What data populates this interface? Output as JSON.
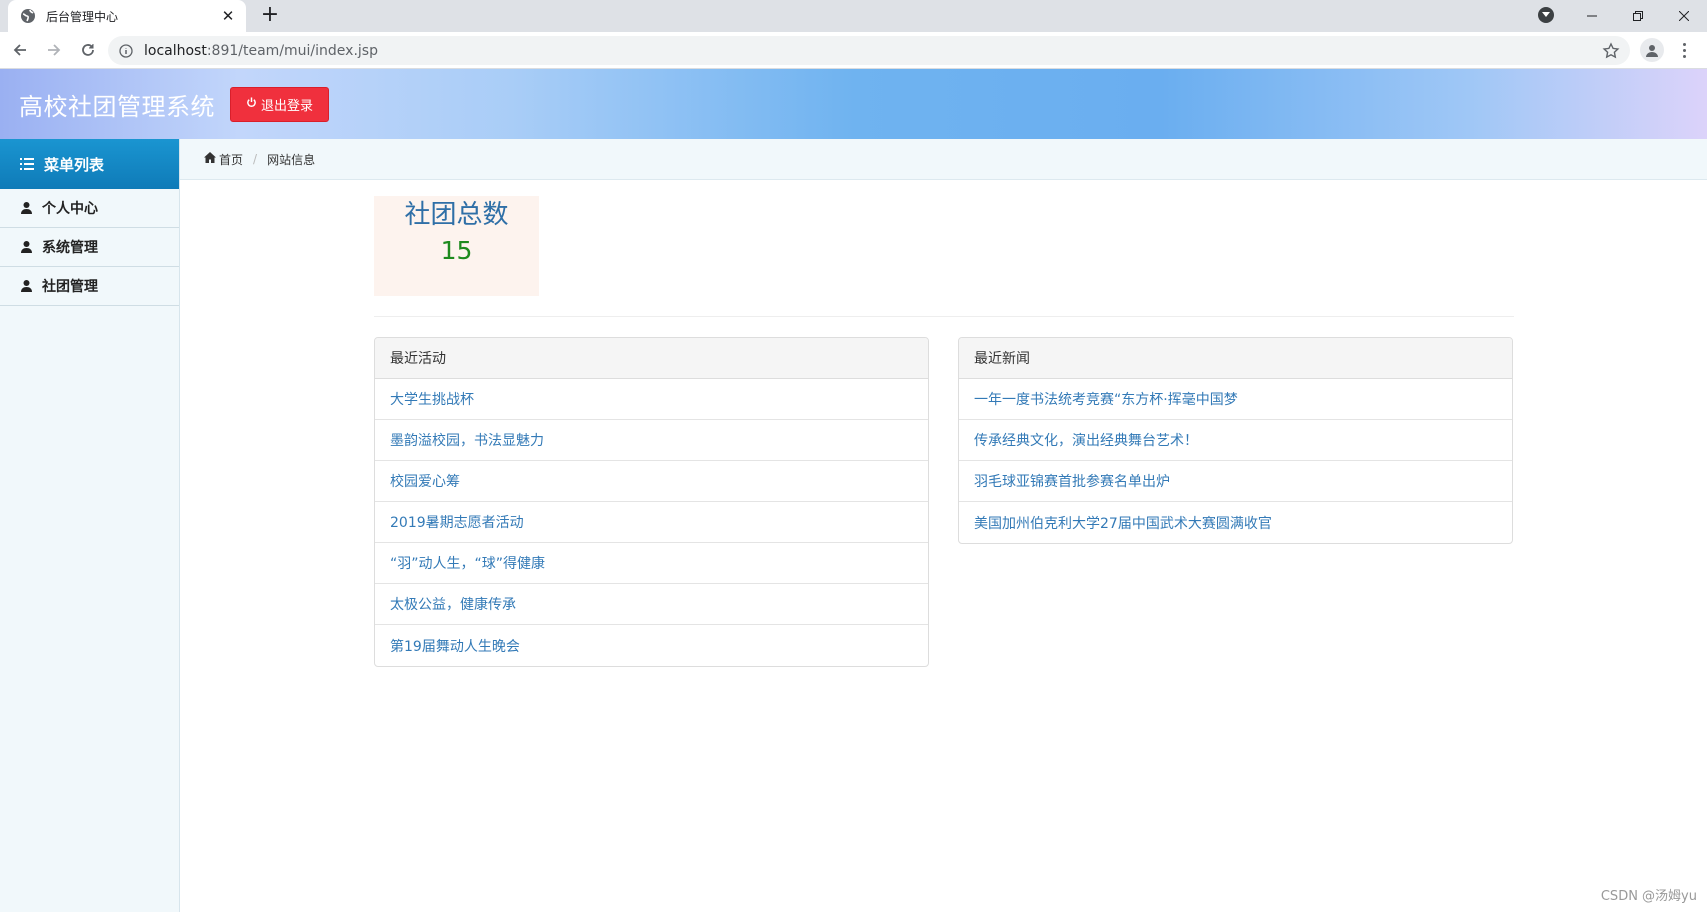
{
  "browser": {
    "tab_title": "后台管理中心",
    "url_host": "localhost",
    "url_rest": ":891/team/mui/index.jsp"
  },
  "header": {
    "title": "高校社团管理系统",
    "logout_label": "退出登录"
  },
  "sidebar": {
    "menu_title": "菜单列表",
    "items": [
      {
        "label": "个人中心"
      },
      {
        "label": "系统管理"
      },
      {
        "label": "社团管理"
      }
    ]
  },
  "breadcrumb": {
    "home": "首页",
    "current": "网站信息"
  },
  "stats": {
    "label": "社团总数",
    "value": "15"
  },
  "activities": {
    "title": "最近活动",
    "items": [
      "大学生挑战杯",
      "墨韵溢校园，书法显魅力",
      "校园爱心筹",
      "2019暑期志愿者活动",
      "“羽”动人生，“球”得健康",
      "太极公益，健康传承",
      "第19届舞动人生晚会"
    ]
  },
  "news": {
    "title": "最近新闻",
    "items": [
      "一年一度书法统考竞赛“东方杯·挥毫中国梦",
      "传承经典文化，演出经典舞台艺术！",
      "羽毛球亚锦赛首批参赛名单出炉",
      "美国加州伯克利大学27届中国武术大赛圆满收官"
    ]
  },
  "watermark": "CSDN @汤姆yu",
  "colors": {
    "logout_red": "#f0303d",
    "menu_head_blue": "#1a95d1",
    "link_blue": "#337ab7",
    "stat_label_blue": "#2f6fa7",
    "stat_value_green": "#1e8a1e"
  }
}
